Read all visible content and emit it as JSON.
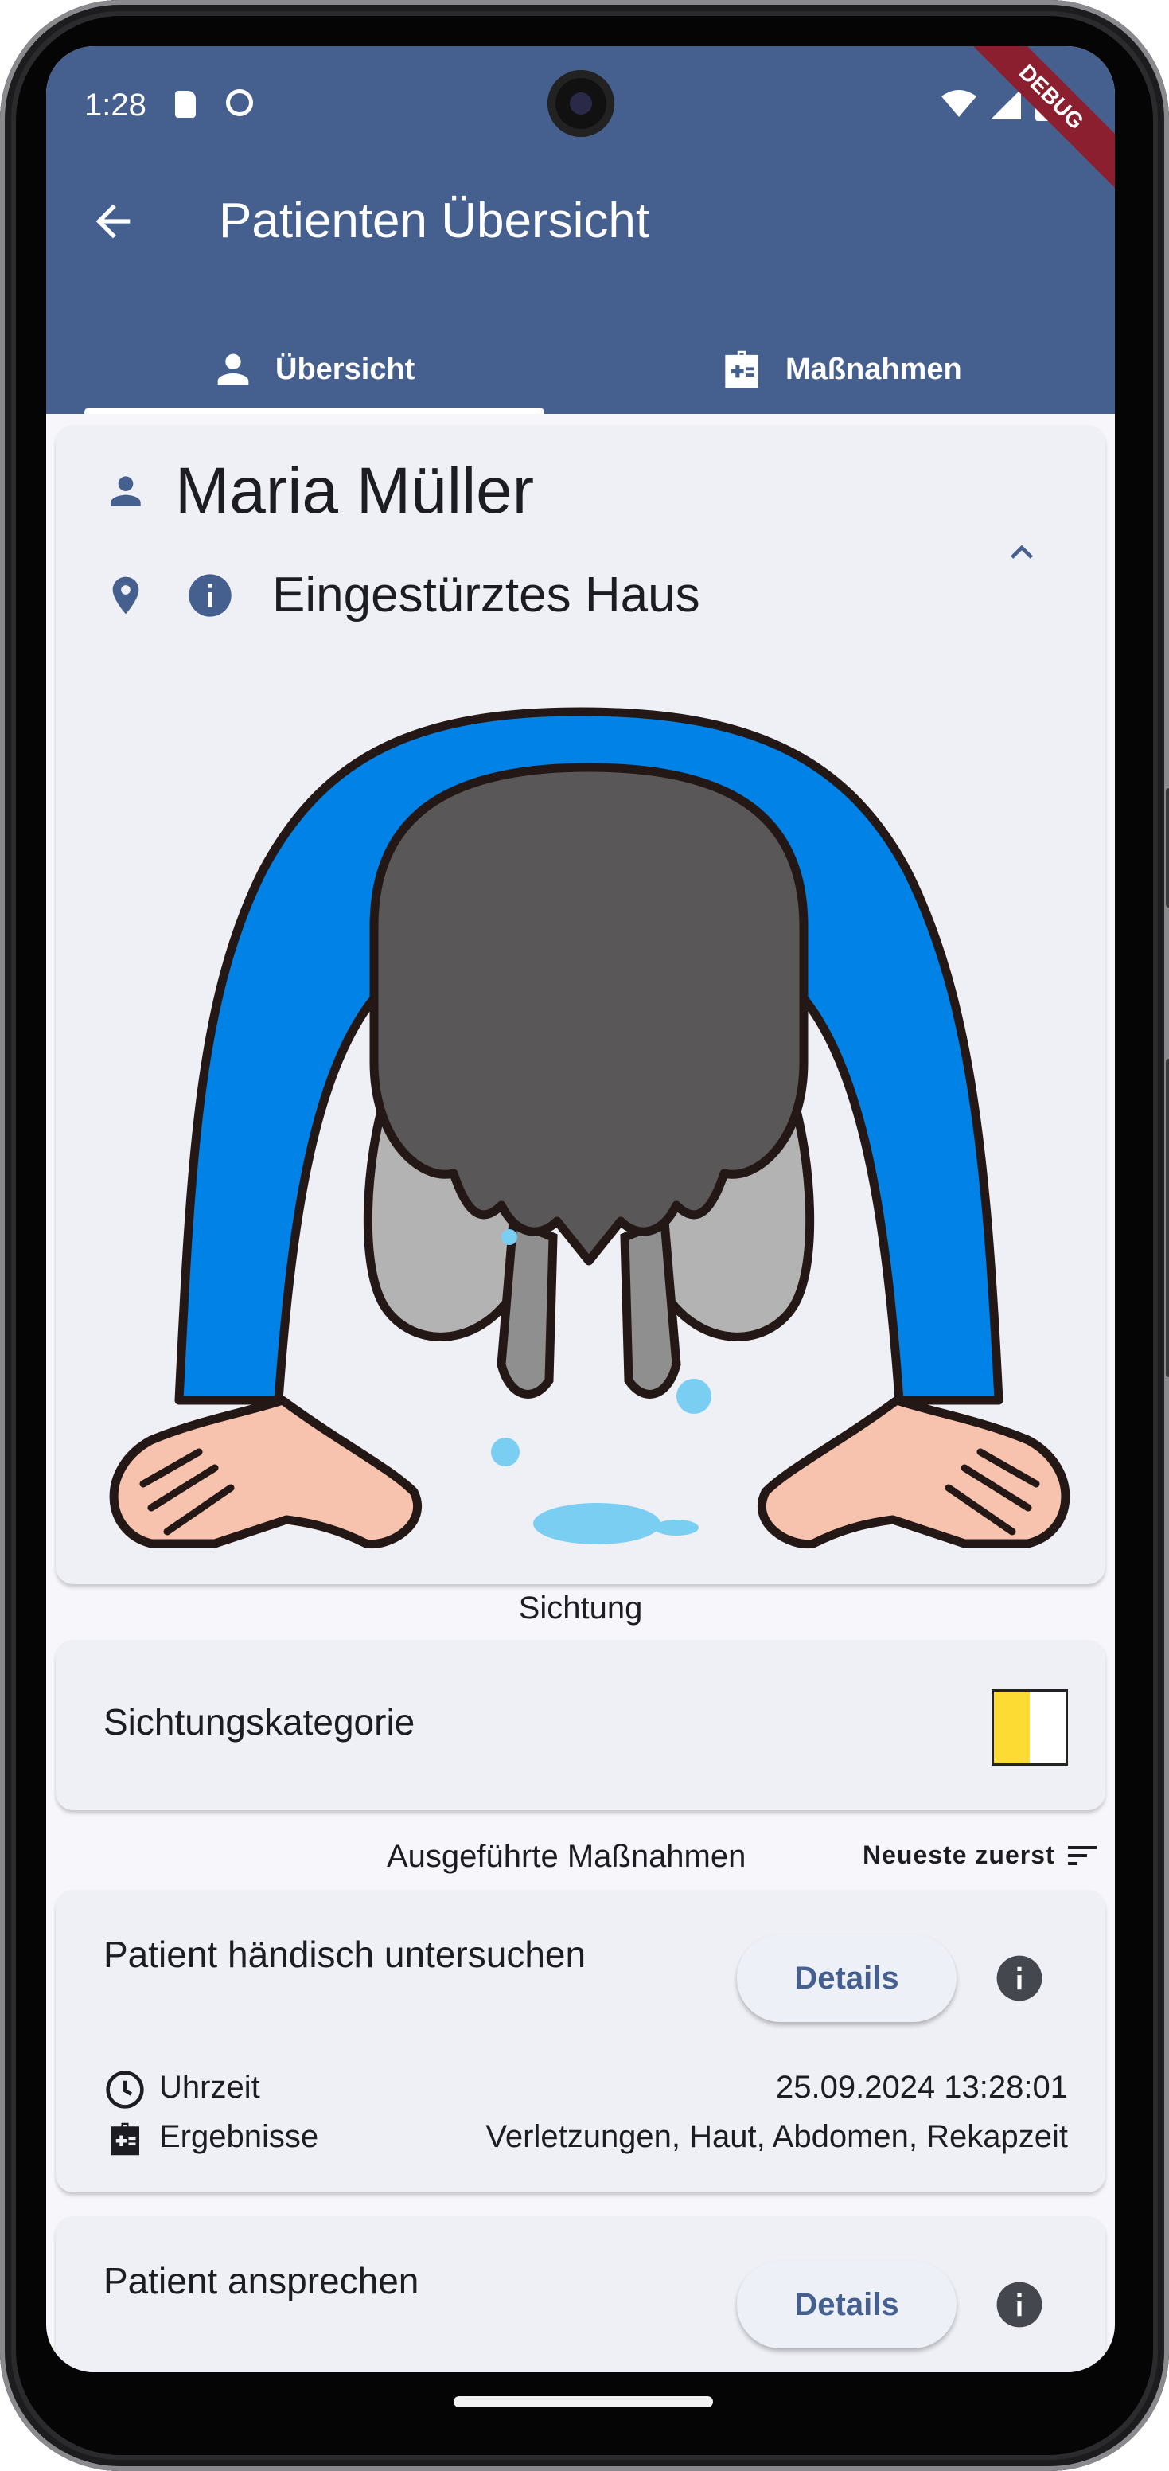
{
  "status_bar": {
    "time": "1:28",
    "debug_banner": "DEBUG"
  },
  "app_bar": {
    "title": "Patienten Übersicht"
  },
  "tabs": [
    {
      "label": "Übersicht",
      "icon": "person-icon",
      "selected": true
    },
    {
      "label": "Maßnahmen",
      "icon": "medical-kit-icon",
      "selected": false
    }
  ],
  "patient": {
    "name": "Maria Müller",
    "location": "Eingestürztes Haus",
    "illustration": "person-crawling-crying"
  },
  "sighting": {
    "section_label": "Sichtung",
    "category_label": "Sichtungskategorie",
    "category_colors": [
      "#fddb33",
      "#ffffff"
    ]
  },
  "measures": {
    "section_label": "Ausgeführte Maßnahmen",
    "sort_label": "Neueste zuerst",
    "items": [
      {
        "title": "Patient händisch untersuchen",
        "details_label": "Details",
        "time_label": "Uhrzeit",
        "time_value": "25.09.2024 13:28:01",
        "results_label": "Ergebnisse",
        "results_value": "Verletzungen, Haut, Abdomen, Rekapzeit"
      },
      {
        "title": "Patient ansprechen",
        "details_label": "Details"
      }
    ]
  },
  "colors": {
    "primary": "#45608f",
    "card": "#eff0f6",
    "background": "#f6f6fb"
  }
}
